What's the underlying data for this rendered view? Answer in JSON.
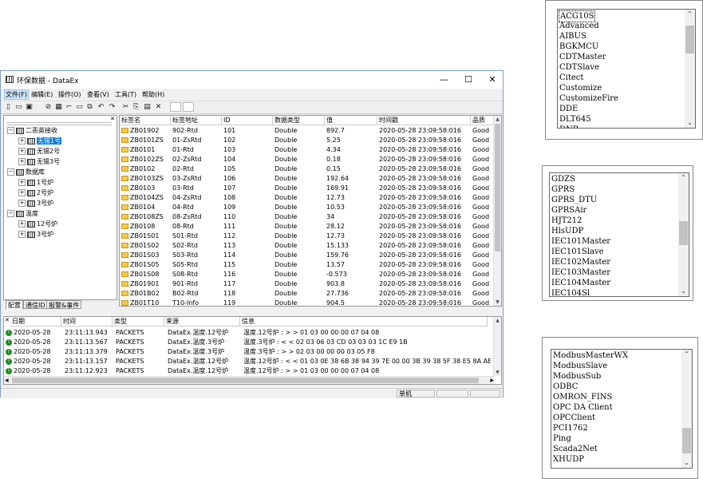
{
  "window": {
    "title": "环保数据 - DataEx",
    "controls": {
      "minimize": "—",
      "maximize": "☐",
      "close": "✕"
    },
    "menu": [
      "文件(F)",
      "编辑(E)",
      "操作(O)",
      "查看(V)",
      "工具(T)",
      "帮助(H)"
    ],
    "toolbar_icons": [
      "new-icon",
      "open-icon",
      "save-icon",
      "link-icon",
      "table-icon",
      "insert-icon",
      "window-icon",
      "copy-window-icon",
      "undo-icon",
      "redo-icon",
      "cut-icon",
      "copy-icon",
      "paste-icon",
      "delete-icon"
    ]
  },
  "tree": {
    "groups": [
      {
        "label": "二恶英接收",
        "children": [
          "无锡1号",
          "无锡2号",
          "无锡3号"
        ]
      },
      {
        "label": "数据库",
        "children": [
          "1号炉",
          "2号炉",
          "3号炉"
        ]
      },
      {
        "label": "温度",
        "children": [
          "12号炉",
          "3号炉"
        ]
      }
    ],
    "selected": "无锡1号",
    "tabs": [
      "配置",
      "通信ID",
      "报警&事件"
    ]
  },
  "tags": {
    "columns": [
      "标签名",
      "标签地址",
      "ID",
      "数据类型",
      "值",
      "时间戳",
      "品质"
    ],
    "rows": [
      [
        "ZB01902",
        "902-Rtd",
        "101",
        "Double",
        "892.7",
        "2020-05-28 23:09:58:016",
        "Good"
      ],
      [
        "ZB0101ZS",
        "01-ZsRtd",
        "102",
        "Double",
        "5.25",
        "2020-05-28 23:09:58:016",
        "Good"
      ],
      [
        "ZB0101",
        "01-Rtd",
        "103",
        "Double",
        "4.34",
        "2020-05-28 23:09:58:016",
        "Good"
      ],
      [
        "ZB0102ZS",
        "02-ZsRtd",
        "104",
        "Double",
        "0.18",
        "2020-05-28 23:09:58:016",
        "Good"
      ],
      [
        "ZB0102",
        "02-Rtd",
        "105",
        "Double",
        "0.15",
        "2020-05-28 23:09:58:016",
        "Good"
      ],
      [
        "ZB0103ZS",
        "03-ZsRtd",
        "106",
        "Double",
        "192.64",
        "2020-05-28 23:09:58:016",
        "Good"
      ],
      [
        "ZB0103",
        "03-Rtd",
        "107",
        "Double",
        "169.91",
        "2020-05-28 23:09:58:016",
        "Good"
      ],
      [
        "ZB0104ZS",
        "04-ZsRtd",
        "108",
        "Double",
        "12.73",
        "2020-05-28 23:09:58:016",
        "Good"
      ],
      [
        "ZB0104",
        "04-Rtd",
        "109",
        "Double",
        "10.53",
        "2020-05-28 23:09:58:016",
        "Good"
      ],
      [
        "ZB0108ZS",
        "08-ZsRtd",
        "110",
        "Double",
        "34",
        "2020-05-28 23:09:58:016",
        "Good"
      ],
      [
        "ZB0108",
        "08-Rtd",
        "111",
        "Double",
        "28.12",
        "2020-05-28 23:09:58:016",
        "Good"
      ],
      [
        "ZB01S01",
        "S01-Rtd",
        "112",
        "Double",
        "12.73",
        "2020-05-28 23:09:58:016",
        "Good"
      ],
      [
        "ZB01S02",
        "S02-Rtd",
        "113",
        "Double",
        "15.133",
        "2020-05-28 23:09:58:016",
        "Good"
      ],
      [
        "ZB01S03",
        "S03-Rtd",
        "114",
        "Double",
        "159.76",
        "2020-05-28 23:09:58:016",
        "Good"
      ],
      [
        "ZB01S05",
        "S05-Rtd",
        "115",
        "Double",
        "13.57",
        "2020-05-28 23:09:58:016",
        "Good"
      ],
      [
        "ZB01S08",
        "S08-Rtd",
        "116",
        "Double",
        "-0.573",
        "2020-05-28 23:09:58:016",
        "Good"
      ],
      [
        "ZB01901",
        "901-Rtd",
        "117",
        "Double",
        "903.8",
        "2020-05-28 23:09:58:016",
        "Good"
      ],
      [
        "ZB01B02",
        "B02-Rtd",
        "118",
        "Double",
        "27.736",
        "2020-05-28 23:09:58:016",
        "Good"
      ],
      [
        "ZB01T10",
        "T10-Info",
        "119",
        "Double",
        "904.5",
        "2020-05-28 23:09:58:016",
        "Good"
      ]
    ]
  },
  "log": {
    "columns": [
      "日期",
      "时间",
      "类型",
      "来源",
      "信息"
    ],
    "rows": [
      [
        "2020-05-28",
        "23:11:13.943",
        "PACKETS",
        "DataEx.温度.12号炉",
        "温度.12号炉 : > > 01 03 00 00 00 07 04 08"
      ],
      [
        "2020-05-28",
        "23:11:13.567",
        "PACKETS",
        "DataEx.温度.3号炉",
        "温度.3号炉 : < < 02 03 06 03 CD 03 03 03 1C E9 1B"
      ],
      [
        "2020-05-28",
        "23:11:13.379",
        "PACKETS",
        "DataEx.温度.3号炉",
        "温度.3号炉 : > > 02 03 00 00 00 03 05 F8"
      ],
      [
        "2020-05-28",
        "23:11:13.157",
        "PACKETS",
        "DataEx.温度.12号炉",
        "温度.12号炉 : < < 01 03 0E 38 6B 38 94 39 7E 00 00 3B 39 38 5F 38 E5 8A AE"
      ],
      [
        "2020-05-28",
        "23:11:12.923",
        "PACKETS",
        "DataEx.温度.12号炉",
        "温度.12号炉 : > > 01 03 00 00 00 07 04 08"
      ]
    ]
  },
  "statusbar": {
    "mode": "单机"
  },
  "driver_lists": [
    {
      "items": [
        "ACG10S",
        "Advanced",
        "AIBUS",
        "BGKMCU",
        "CDTMaster",
        "CDTSlave",
        "Citect",
        "Customize",
        "CustomizeFire",
        "DDE",
        "DLT645",
        "DNP"
      ],
      "focused": "ACG10S"
    },
    {
      "items": [
        "GDZS",
        "GPRS",
        "GPRS_DTU",
        "GPRSAir",
        "HJT212",
        "HlsUDP",
        "IEC101Master",
        "IEC101Slave",
        "IEC102Master",
        "IEC103Master",
        "IEC104Master",
        "IEC104Sl"
      ]
    },
    {
      "items": [
        "ModbusMasterWX",
        "ModbusSlave",
        "ModbusSub",
        "ODBC",
        "OMRON_FINS",
        "OPC DA Client",
        "OPCClient",
        "PCI1762",
        "Ping",
        "Scada2Net",
        "XHUDP"
      ]
    }
  ]
}
